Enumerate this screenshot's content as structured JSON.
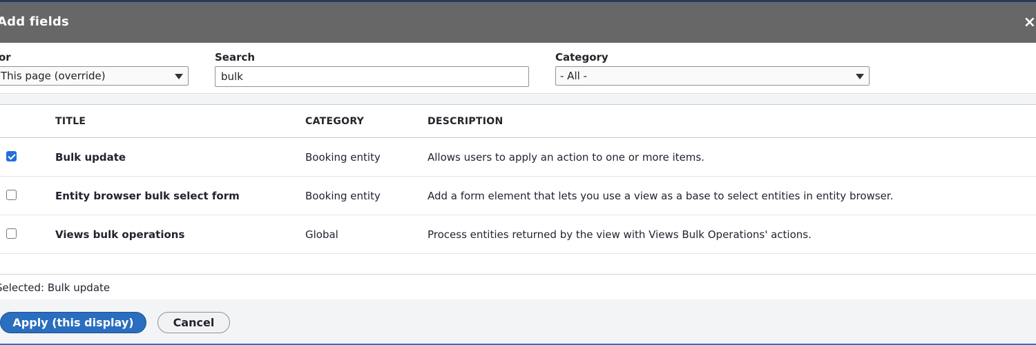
{
  "dialog": {
    "title": "Add fields",
    "close_icon": "×"
  },
  "filters": {
    "for_label": "or",
    "for_value": "This page (override)",
    "search_label": "Search",
    "search_value": "bulk",
    "category_label": "Category",
    "category_value": "- All -"
  },
  "table": {
    "headers": [
      "TITLE",
      "CATEGORY",
      "DESCRIPTION"
    ],
    "rows": [
      {
        "checked": true,
        "title": "Bulk update",
        "category": "Booking entity",
        "description": "Allows users to apply an action to one or more items."
      },
      {
        "checked": false,
        "title": "Entity browser bulk select form",
        "category": "Booking entity",
        "description": "Add a form element that lets you use a view as a base to select entities in entity browser."
      },
      {
        "checked": false,
        "title": "Views bulk operations",
        "category": "Global",
        "description": "Process entities returned by the view with Views Bulk Operations' actions."
      }
    ]
  },
  "selected_text": "Selected: Bulk update",
  "buttons": {
    "apply": "Apply (this display)",
    "cancel": "Cancel"
  },
  "colors": {
    "titlebar": "#676767",
    "primary": "#2a6ebf",
    "checkbox_checked": "#1f6fde"
  }
}
